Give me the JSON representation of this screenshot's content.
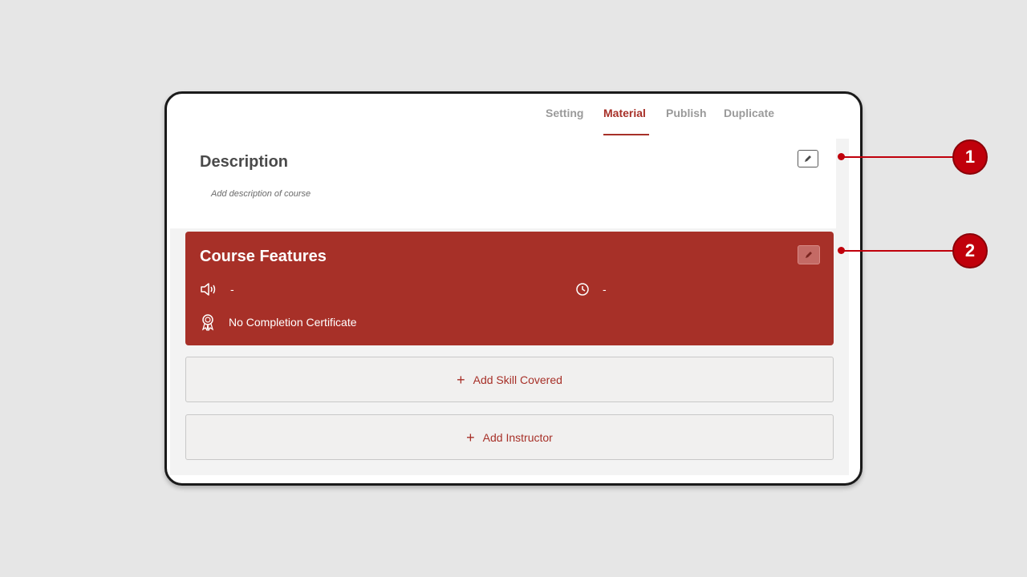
{
  "tabs": [
    {
      "label": "Setting"
    },
    {
      "label": "Material"
    },
    {
      "label": "Publish"
    },
    {
      "label": "Duplicate"
    }
  ],
  "active_tab": "Material",
  "description": {
    "title": "Description",
    "placeholder": "Add description of course"
  },
  "course_features": {
    "title": "Course Features",
    "audio_value": "-",
    "duration_value": "-",
    "certificate": "No Completion Certificate"
  },
  "actions": {
    "add_skill": "Add Skill Covered",
    "add_instructor": "Add Instructor"
  },
  "callouts": [
    "1",
    "2"
  ],
  "colors": {
    "accent": "#a73028",
    "callout": "#c0000b"
  },
  "icons": [
    "edit-icon",
    "speaker-icon",
    "clock-icon",
    "award-icon",
    "plus-icon"
  ]
}
